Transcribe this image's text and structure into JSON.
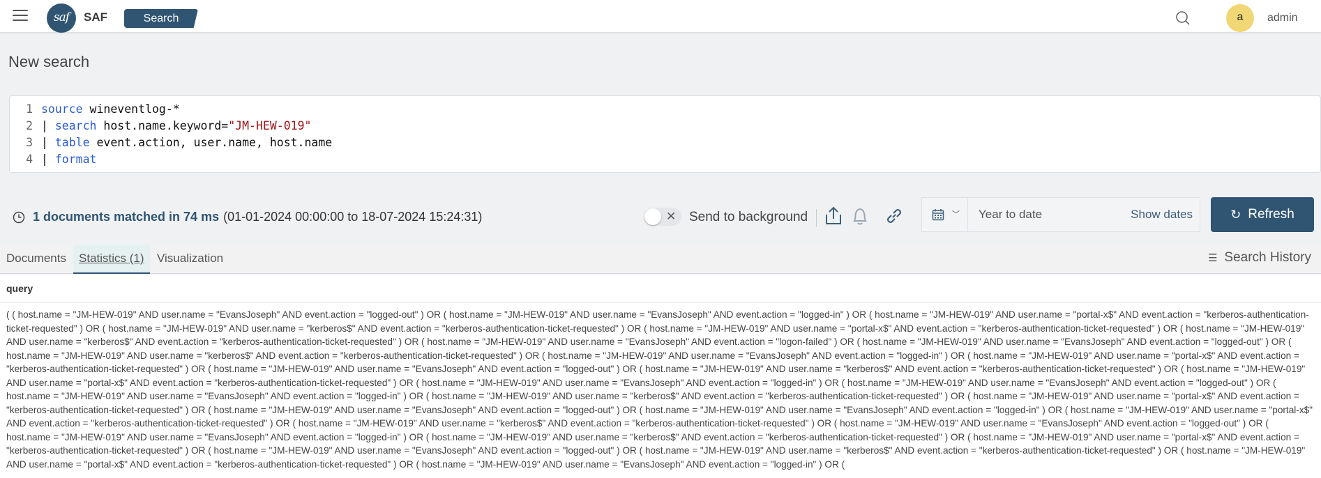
{
  "nav": {
    "logo_text": "saf",
    "brand": "SAF",
    "active_section": "Search",
    "user_initial": "a",
    "username": "admin",
    "icons": [
      "menu-icon",
      "search-icon"
    ]
  },
  "page": {
    "title": "New search"
  },
  "editor": {
    "lines": [
      {
        "num": "1",
        "pipe": "",
        "keyword": "source",
        "text": " wineventlog-*",
        "string": ""
      },
      {
        "num": "2",
        "pipe": "| ",
        "keyword": "search",
        "text": " host.name.keyword=",
        "string": "\"JM-HEW-019\""
      },
      {
        "num": "3",
        "pipe": "| ",
        "keyword": "table",
        "text": " event.action, user.name, host.name",
        "string": ""
      },
      {
        "num": "4",
        "pipe": "| ",
        "keyword": "format",
        "text": "",
        "string": ""
      }
    ]
  },
  "status": {
    "matched": "1 documents matched in 74 ms",
    "range": "(01-01-2024 00:00:00 to 18-07-2024 15:24:31)",
    "background_toggle": false,
    "background_label": "Send to background"
  },
  "timepicker": {
    "range_label": "Year to date",
    "show_dates_label": "Show dates",
    "refresh_label": "Refresh"
  },
  "tabs": [
    {
      "label": "Documents",
      "active": false
    },
    {
      "label": "Statistics (1)",
      "active": true
    },
    {
      "label": "Visualization",
      "active": false
    }
  ],
  "search_history_label": "Search History",
  "results": {
    "columns": [
      "query"
    ],
    "rows": [
      [
        "( ( host.name = \"JM-HEW-019\" AND user.name = \"EvansJoseph\" AND event.action = \"logged-out\" ) OR ( host.name = \"JM-HEW-019\" AND user.name = \"EvansJoseph\" AND event.action = \"logged-in\" ) OR ( host.name = \"JM-HEW-019\" AND user.name = \"portal-x$\" AND event.action = \"kerberos-authentication-ticket-requested\" ) OR ( host.name = \"JM-HEW-019\" AND user.name = \"kerberos$\" AND event.action = \"kerberos-authentication-ticket-requested\" ) OR ( host.name = \"JM-HEW-019\" AND user.name = \"portal-x$\" AND event.action = \"kerberos-authentication-ticket-requested\" ) OR ( host.name = \"JM-HEW-019\" AND user.name = \"kerberos$\" AND event.action = \"kerberos-authentication-ticket-requested\" ) OR ( host.name = \"JM-HEW-019\" AND user.name = \"EvansJoseph\" AND event.action = \"logon-failed\" ) OR ( host.name = \"JM-HEW-019\" AND user.name = \"EvansJoseph\" AND event.action = \"logged-out\" ) OR ( host.name = \"JM-HEW-019\" AND user.name = \"kerberos$\" AND event.action = \"kerberos-authentication-ticket-requested\" ) OR ( host.name = \"JM-HEW-019\" AND user.name = \"EvansJoseph\" AND event.action = \"logged-in\" ) OR ( host.name = \"JM-HEW-019\" AND user.name = \"portal-x$\" AND event.action = \"kerberos-authentication-ticket-requested\" ) OR ( host.name = \"JM-HEW-019\" AND user.name = \"EvansJoseph\" AND event.action = \"logged-out\" ) OR ( host.name = \"JM-HEW-019\" AND user.name = \"kerberos$\" AND event.action = \"kerberos-authentication-ticket-requested\" ) OR ( host.name = \"JM-HEW-019\" AND user.name = \"portal-x$\" AND event.action = \"kerberos-authentication-ticket-requested\" ) OR ( host.name = \"JM-HEW-019\" AND user.name = \"EvansJoseph\" AND event.action = \"logged-in\" ) OR ( host.name = \"JM-HEW-019\" AND user.name = \"EvansJoseph\" AND event.action = \"logged-out\" ) OR ( host.name = \"JM-HEW-019\" AND user.name = \"EvansJoseph\" AND event.action = \"logged-in\" ) OR ( host.name = \"JM-HEW-019\" AND user.name = \"kerberos$\" AND event.action = \"kerberos-authentication-ticket-requested\" ) OR ( host.name = \"JM-HEW-019\" AND user.name = \"portal-x$\" AND event.action = \"kerberos-authentication-ticket-requested\" ) OR ( host.name = \"JM-HEW-019\" AND user.name = \"EvansJoseph\" AND event.action = \"logged-out\" ) OR ( host.name = \"JM-HEW-019\" AND user.name = \"EvansJoseph\" AND event.action = \"logged-in\" ) OR ( host.name = \"JM-HEW-019\" AND user.name = \"portal-x$\" AND event.action = \"kerberos-authentication-ticket-requested\" ) OR ( host.name = \"JM-HEW-019\" AND user.name = \"kerberos$\" AND event.action = \"kerberos-authentication-ticket-requested\" ) OR ( host.name = \"JM-HEW-019\" AND user.name = \"EvansJoseph\" AND event.action = \"logged-out\" ) OR ( host.name = \"JM-HEW-019\" AND user.name = \"EvansJoseph\" AND event.action = \"logged-in\" ) OR ( host.name = \"JM-HEW-019\" AND user.name = \"kerberos$\" AND event.action = \"kerberos-authentication-ticket-requested\" ) OR ( host.name = \"JM-HEW-019\" AND user.name = \"portal-x$\" AND event.action = \"kerberos-authentication-ticket-requested\" ) OR ( host.name = \"JM-HEW-019\" AND user.name = \"EvansJoseph\" AND event.action = \"logged-out\" ) OR ( host.name = \"JM-HEW-019\" AND user.name = \"kerberos$\" AND event.action = \"kerberos-authentication-ticket-requested\" ) OR ( host.name = \"JM-HEW-019\" AND user.name = \"portal-x$\" AND event.action = \"kerberos-authentication-ticket-requested\" ) OR ( host.name = \"JM-HEW-019\" AND user.name = \"EvansJoseph\" AND event.action = \"logged-in\" ) OR ("
      ]
    ]
  }
}
